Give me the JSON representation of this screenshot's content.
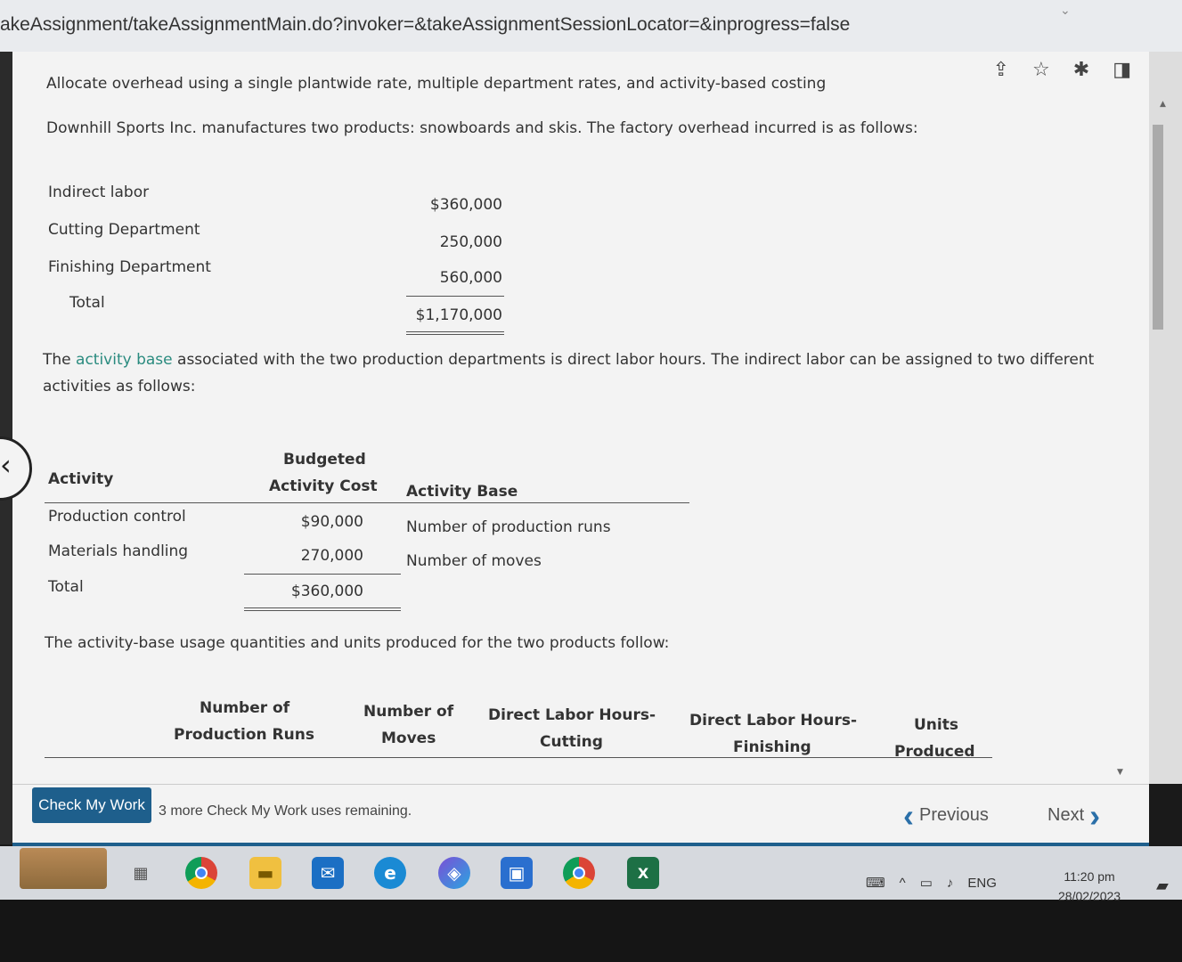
{
  "browser": {
    "url": "akeAssignment/takeAssignmentMain.do?invoker=&takeAssignmentSessionLocator=&inprogress=false"
  },
  "content": {
    "heading": "Allocate overhead using a single plantwide rate, multiple department rates, and activity-based costing",
    "intro": "Downhill Sports Inc. manufactures two products: snowboards and skis. The factory overhead incurred is as follows:",
    "overhead": {
      "rows": [
        {
          "label": "Indirect labor",
          "value": "$360,000"
        },
        {
          "label": "Cutting Department",
          "value": "250,000"
        },
        {
          "label": "Finishing Department",
          "value": "560,000"
        }
      ],
      "total_label": "Total",
      "total_value": "$1,170,000"
    },
    "activity_para_1a": "The ",
    "activity_para_link": "activity base",
    "activity_para_1b": " associated with the two production departments is direct labor hours. The indirect labor can be assigned to two different",
    "activity_para_2": "activities as follows:",
    "activity_table": {
      "col_activity": "Activity",
      "col_cost_line1": "Budgeted",
      "col_cost_line2": "Activity Cost",
      "col_base": "Activity Base",
      "rows": [
        {
          "activity": "Production control",
          "cost": "$90,000",
          "base": "Number of production runs"
        },
        {
          "activity": "Materials handling",
          "cost": "270,000",
          "base": "Number of moves"
        }
      ],
      "total_label": "Total",
      "total_value": "$360,000"
    },
    "usage_para": "The activity-base usage quantities and units produced for the two products follow:",
    "usage_headers": [
      {
        "line1": "Number of",
        "line2": "Production Runs"
      },
      {
        "line1": "Number of",
        "line2": "Moves"
      },
      {
        "line1": "Direct Labor Hours-",
        "line2": "Cutting"
      },
      {
        "line1": "Direct Labor Hours-",
        "line2": "Finishing"
      },
      {
        "line1": "Units",
        "line2": "Produced"
      }
    ]
  },
  "footer": {
    "check_label": "Check My Work",
    "uses_text": "3 more Check My Work uses remaining.",
    "previous_label": "Previous",
    "next_label": "Next"
  },
  "taskbar": {
    "lang": "ENG",
    "time": "11:20 pm",
    "date": "28/02/2023",
    "apps": [
      "task-view-icon",
      "chrome-icon",
      "file-explorer-icon",
      "mail-icon",
      "edge-icon",
      "copilot-icon",
      "store-icon",
      "chrome-icon",
      "excel-icon"
    ]
  }
}
